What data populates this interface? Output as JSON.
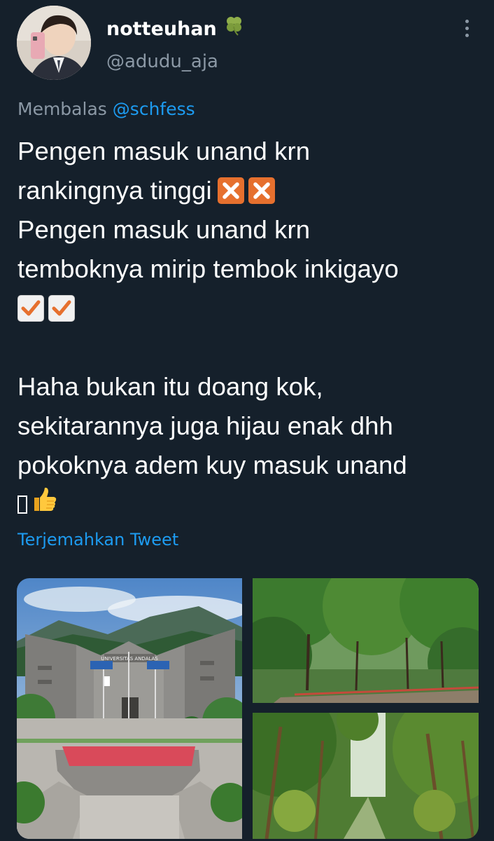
{
  "author": {
    "display_name": "notteuhan",
    "badge_icon": "clover-icon",
    "handle": "@adudu_aja"
  },
  "reply": {
    "label": "Membalas",
    "mention": "@schfess"
  },
  "tweet": {
    "line1": "Pengen masuk unand krn",
    "line2": "rankingnya tinggi",
    "line2_emojis": [
      "cross-mark-icon",
      "cross-mark-icon"
    ],
    "line3": "Pengen masuk unand krn",
    "line4": "temboknya mirip tembok inkigayo",
    "line5_emojis": [
      "check-mark-icon",
      "check-mark-icon"
    ],
    "line6": "Haha bukan itu doang kok,",
    "line7": "sekitarannya juga hijau enak dhh",
    "line8": "pokoknya adem kuy masuk unand",
    "line9_emojis": [
      "missing-glyph",
      "thumbs-up-icon"
    ]
  },
  "translate_label": "Terjemahkan Tweet",
  "media": {
    "photos": [
      "campus-building-photo",
      "tree-lined-road-photo",
      "forest-path-photo"
    ],
    "sign_text": "UNIVERSITAS ANDALAS"
  },
  "colors": {
    "background": "#15202b",
    "link": "#1d9bf0",
    "secondary_text": "#8b98a5",
    "cross_emoji": "#e6702e"
  }
}
